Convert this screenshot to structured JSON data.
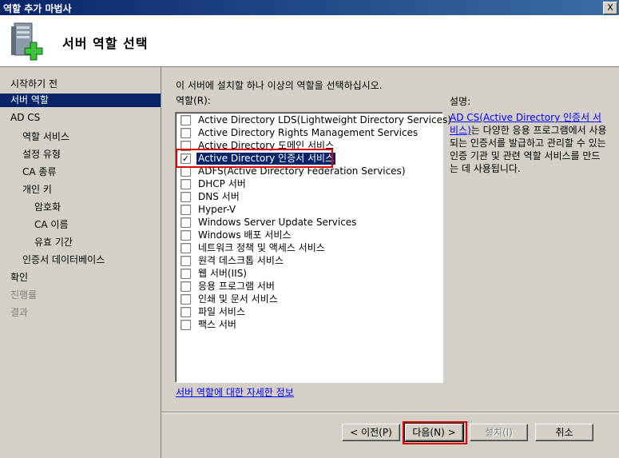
{
  "window": {
    "title": "역할 추가 마법사",
    "close_label": "X"
  },
  "header": {
    "title": "서버 역할 선택"
  },
  "sidebar": {
    "steps": [
      {
        "label": "시작하기 전",
        "state": "normal"
      },
      {
        "label": "서버 역할",
        "state": "current"
      },
      {
        "label": "AD CS",
        "state": "normal"
      },
      {
        "label": "역할 서비스",
        "state": "normal"
      },
      {
        "label": "설정 유형",
        "state": "normal"
      },
      {
        "label": "CA 종류",
        "state": "normal"
      },
      {
        "label": "개인 키",
        "state": "normal"
      },
      {
        "label": "암호화",
        "state": "normal"
      },
      {
        "label": "CA 이름",
        "state": "normal"
      },
      {
        "label": "유효 기간",
        "state": "normal"
      },
      {
        "label": "인증서 데이터베이스",
        "state": "normal"
      },
      {
        "label": "확인",
        "state": "normal"
      },
      {
        "label": "진행률",
        "state": "disabled"
      },
      {
        "label": "결과",
        "state": "disabled"
      }
    ]
  },
  "main": {
    "instruction": "이 서버에 설치할 하나 이상의 역할을 선택하십시오.",
    "roles_label": "역할(R):",
    "roles": [
      {
        "label": "Active Directory LDS(Lightweight Directory Services)",
        "checked": false
      },
      {
        "label": "Active Directory Rights Management Services",
        "checked": false
      },
      {
        "label": "Active Directory 도메인 서비스",
        "checked": false
      },
      {
        "label": "Active Directory 인증서 서비스",
        "checked": true,
        "selected": true
      },
      {
        "label": "ADFS(Active Directory Federation Services)",
        "checked": false
      },
      {
        "label": "DHCP 서버",
        "checked": false
      },
      {
        "label": "DNS 서버",
        "checked": false
      },
      {
        "label": "Hyper-V",
        "checked": false
      },
      {
        "label": "Windows Server Update Services",
        "checked": false
      },
      {
        "label": "Windows 배포 서비스",
        "checked": false
      },
      {
        "label": "네트워크 정책 및 액세스 서비스",
        "checked": false
      },
      {
        "label": "원격 데스크톱 서비스",
        "checked": false
      },
      {
        "label": "웹 서버(IIS)",
        "checked": false
      },
      {
        "label": "응용 프로그램 서버",
        "checked": false
      },
      {
        "label": "인쇄 및 문서 서비스",
        "checked": false
      },
      {
        "label": "파일 서비스",
        "checked": false
      },
      {
        "label": "팩스 서버",
        "checked": false
      }
    ],
    "description_label": "설명:",
    "description_link": "AD CS(Active Directory 인증서 서비스)",
    "description_text": "는 다양한 응용 프로그램에서 사용되는 인증서를 발급하고 관리할 수 있는 인증 기관 및 관련 역할 서비스를 만드는 데 사용됩니다.",
    "more_info_link": "서버 역할에 대한 자세한 정보"
  },
  "buttons": {
    "prev": "< 이전(P)",
    "next": "다음(N) >",
    "install": "설치(I)",
    "cancel": "취소"
  },
  "colors": {
    "selection": "#0a246a",
    "highlight": "#e00000",
    "link": "#0000ff"
  }
}
